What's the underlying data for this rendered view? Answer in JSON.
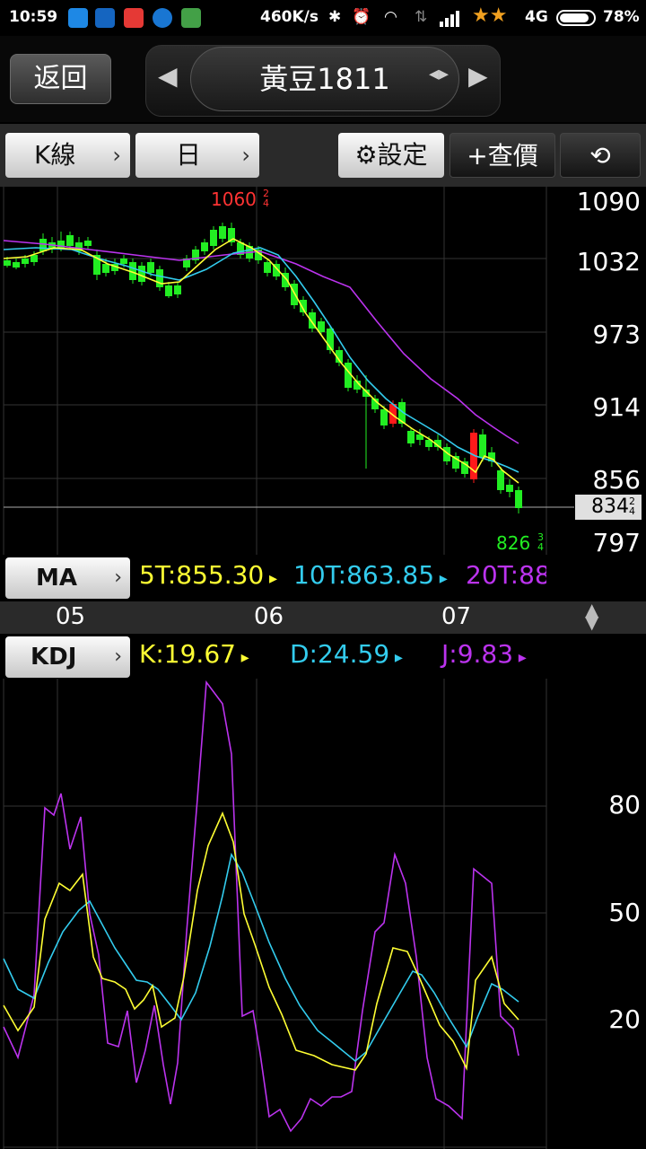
{
  "status_bar": {
    "time": "10:59",
    "speed": "460K/s",
    "network": "4G",
    "battery": "78%"
  },
  "nav": {
    "back_label": "返回",
    "title": "黃豆1811"
  },
  "toolbar": {
    "kline_label": "K線",
    "period_label": "日",
    "settings_label": "設定",
    "quote_label": "+查價"
  },
  "price_chart": {
    "high_label": "1060",
    "high_frac_top": "2",
    "high_frac_bot": "4",
    "low_label": "826",
    "low_frac_top": "3",
    "low_frac_bot": "4",
    "axis_labels": [
      "1090",
      "1032",
      "973",
      "914",
      "856",
      "797"
    ],
    "current_price": "834",
    "current_frac_top": "2",
    "current_frac_bot": "4"
  },
  "ma_indicator": {
    "label": "MA",
    "ma5": "5T:855.30",
    "ma10": "10T:863.85",
    "ma20": "20T:88"
  },
  "date_axis": {
    "labels": [
      "05",
      "06",
      "07"
    ]
  },
  "kdj_indicator": {
    "label": "KDJ",
    "k": "K:19.67",
    "d": "D:24.59",
    "j": "J:9.83",
    "axis_labels": [
      "80",
      "50",
      "20"
    ]
  },
  "colors": {
    "up": "#ff1a1a",
    "down": "#22ee22",
    "ma5": "#ffff33",
    "ma10": "#33ccee",
    "ma20": "#bb33ee",
    "k": "#ffff33",
    "d": "#33ccee",
    "j": "#bb33ee"
  },
  "chart_data": [
    {
      "type": "candlestick",
      "title": "黃豆1811",
      "y_ticks": [
        1090,
        1032,
        973,
        914,
        856,
        797
      ],
      "ylim": [
        797,
        1090
      ],
      "x_ticks": [
        "05",
        "06",
        "07"
      ],
      "series": [
        {
          "name": "5T",
          "value": 855.3
        },
        {
          "name": "10T",
          "value": 863.85
        }
      ],
      "annotations": {
        "high": 1060.5,
        "low": 826.75,
        "last": 834.5
      }
    },
    {
      "type": "line",
      "title": "KDJ",
      "y_ticks": [
        80,
        50,
        20
      ],
      "series": [
        {
          "name": "K",
          "last": 19.67
        },
        {
          "name": "D",
          "last": 24.59
        },
        {
          "name": "J",
          "last": 9.83
        }
      ]
    }
  ]
}
